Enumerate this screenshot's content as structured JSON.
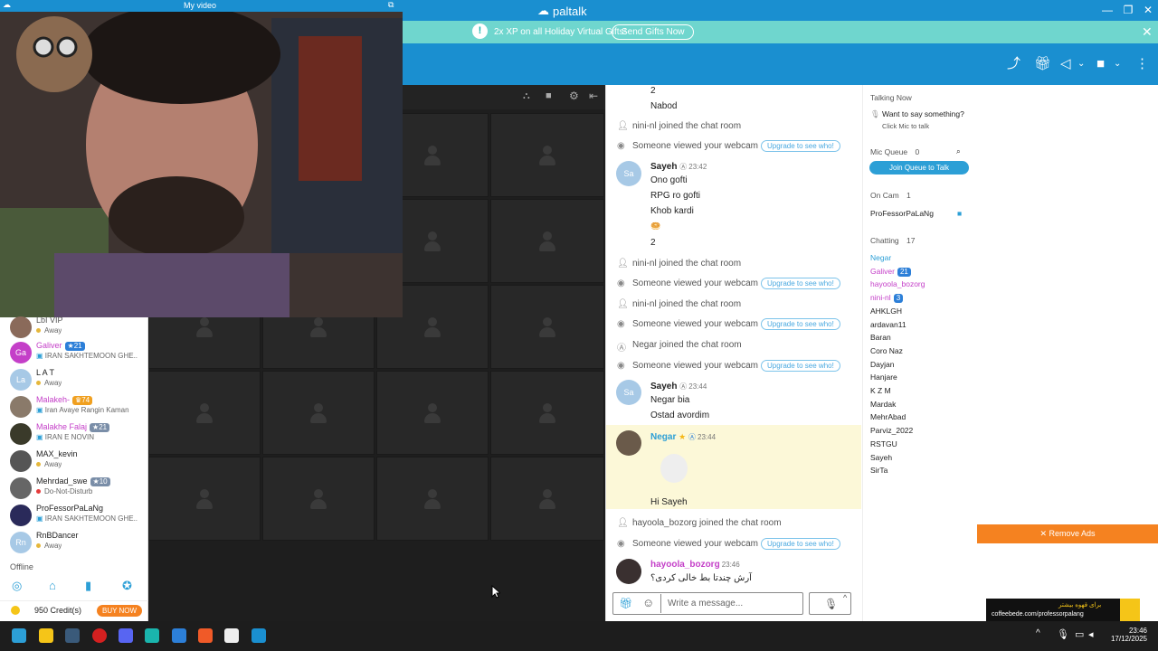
{
  "window": {
    "title": "paltalk",
    "video_label": "My video"
  },
  "promo": {
    "icon": "!",
    "text": "2x XP on all Holiday Virtual Gifts!",
    "button": "Send Gifts Now"
  },
  "left_users": [
    {
      "name": "LbI VIP",
      "status": "Away",
      "initials": "",
      "color": "#8a6a5a"
    },
    {
      "name": "Galiver",
      "badge": "21",
      "status": "IRAN SAKHTEMOON GHE...",
      "initials": "Ga",
      "color": "#c43fc8"
    },
    {
      "name": "L A T",
      "status": "Away",
      "initials": "La",
      "color": "#a7c9e6"
    },
    {
      "name": "Malakeh-",
      "badge": "74",
      "status": "Iran Avaye Rangin Kaman",
      "initials": "",
      "color": "#8a7a6a"
    },
    {
      "name": "Malakhe Falaj",
      "badge": "21",
      "status": "IRAN E NOVIN",
      "initials": "",
      "color": "#3a3a2a"
    },
    {
      "name": "MAX_kevin",
      "status": "Away",
      "initials": "",
      "color": "#555"
    },
    {
      "name": "Mehrdad_swe",
      "badge": "10",
      "status": "Do-Not-Disturb",
      "initials": "",
      "color": "#666"
    },
    {
      "name": "ProFessorPaLaNg",
      "status": "IRAN SAKHTEMOON GHE...",
      "initials": "",
      "color": "#2a2a5a"
    },
    {
      "name": "RnBDancer",
      "status": "Away",
      "initials": "Rn",
      "color": "#a7c9e6"
    }
  ],
  "offline_label": "Offline",
  "credits": {
    "text": "950 Credit(s)",
    "buy": "BUY NOW"
  },
  "chat": {
    "top_lines": [
      "2",
      "Nabod"
    ],
    "sys1": "nini-nl joined the chat room",
    "sys2": "Someone viewed your webcam",
    "upgrade": "Upgrade to see who!",
    "sayeh1": {
      "name": "Sayeh",
      "time": "23:42",
      "initials": "Sa",
      "lines": [
        "Ono gofti",
        "RPG ro gofti",
        "Khob kardi",
        "🥯",
        "2"
      ]
    },
    "sys3": "nini-nl joined the chat room",
    "sys4": "Someone viewed your webcam",
    "sys5": "nini-nl joined the chat room",
    "sys6": "Someone viewed your webcam",
    "sys7": "Negar joined the chat room",
    "sys8": "Someone viewed your webcam",
    "sayeh2": {
      "name": "Sayeh",
      "time": "23:44",
      "initials": "Sa",
      "lines": [
        "Negar bia",
        "Ostad avordim"
      ]
    },
    "negar": {
      "name": "Negar",
      "time": "23:44",
      "line": "Hi Sayeh"
    },
    "sys9": "hayoola_bozorg joined the chat room",
    "sys10": "Someone viewed your webcam",
    "hay": {
      "name": "hayoola_bozorg",
      "time": "23:46",
      "line": "آرش چندتا بط خالی کردی؟"
    },
    "placeholder": "Write a message..."
  },
  "side": {
    "talking_now": "Talking Now",
    "want": "Want to say something?",
    "click_mic": "Click Mic to talk",
    "mic_queue": "Mic Queue",
    "mic_queue_count": "0",
    "join_queue": "Join Queue to Talk",
    "on_cam": "On Cam",
    "on_cam_count": "1",
    "on_cam_user": "ProFessorPaLaNg",
    "chatting": "Chatting",
    "chatting_count": "17",
    "users": [
      {
        "name": "Negar",
        "color": "#2c9fd6",
        "badge": ""
      },
      {
        "name": "Galiver",
        "color": "#c43fc8",
        "badge": "21"
      },
      {
        "name": "hayoola_bozorg",
        "color": "#c43fc8",
        "badge": ""
      },
      {
        "name": "nini-nl",
        "color": "#c43fc8",
        "badge": "3"
      },
      {
        "name": "AHKLGH",
        "color": "#222",
        "badge": ""
      },
      {
        "name": "ardavan11",
        "color": "#222",
        "badge": ""
      },
      {
        "name": "Baran",
        "color": "#222",
        "badge": ""
      },
      {
        "name": "Coro Naz",
        "color": "#222",
        "badge": ""
      },
      {
        "name": "Dayjan",
        "color": "#222",
        "badge": ""
      },
      {
        "name": "Hanjare",
        "color": "#222",
        "badge": ""
      },
      {
        "name": "K Z M",
        "color": "#222",
        "badge": ""
      },
      {
        "name": "Mardak",
        "color": "#222",
        "badge": ""
      },
      {
        "name": "MehrAbad",
        "color": "#222",
        "badge": ""
      },
      {
        "name": "Parviz_2022",
        "color": "#222",
        "badge": ""
      },
      {
        "name": "RSTGU",
        "color": "#222",
        "badge": ""
      },
      {
        "name": "Sayeh",
        "color": "#222",
        "badge": ""
      },
      {
        "name": "SirTa",
        "color": "#222",
        "badge": ""
      }
    ]
  },
  "ads": {
    "remove": "✕ Remove Ads",
    "banner_top": "برای قهوه بیشتر",
    "banner_url": "coffeebede.com/professorpalang"
  },
  "clock": {
    "time": "23:46",
    "date": "17/12/2025"
  }
}
